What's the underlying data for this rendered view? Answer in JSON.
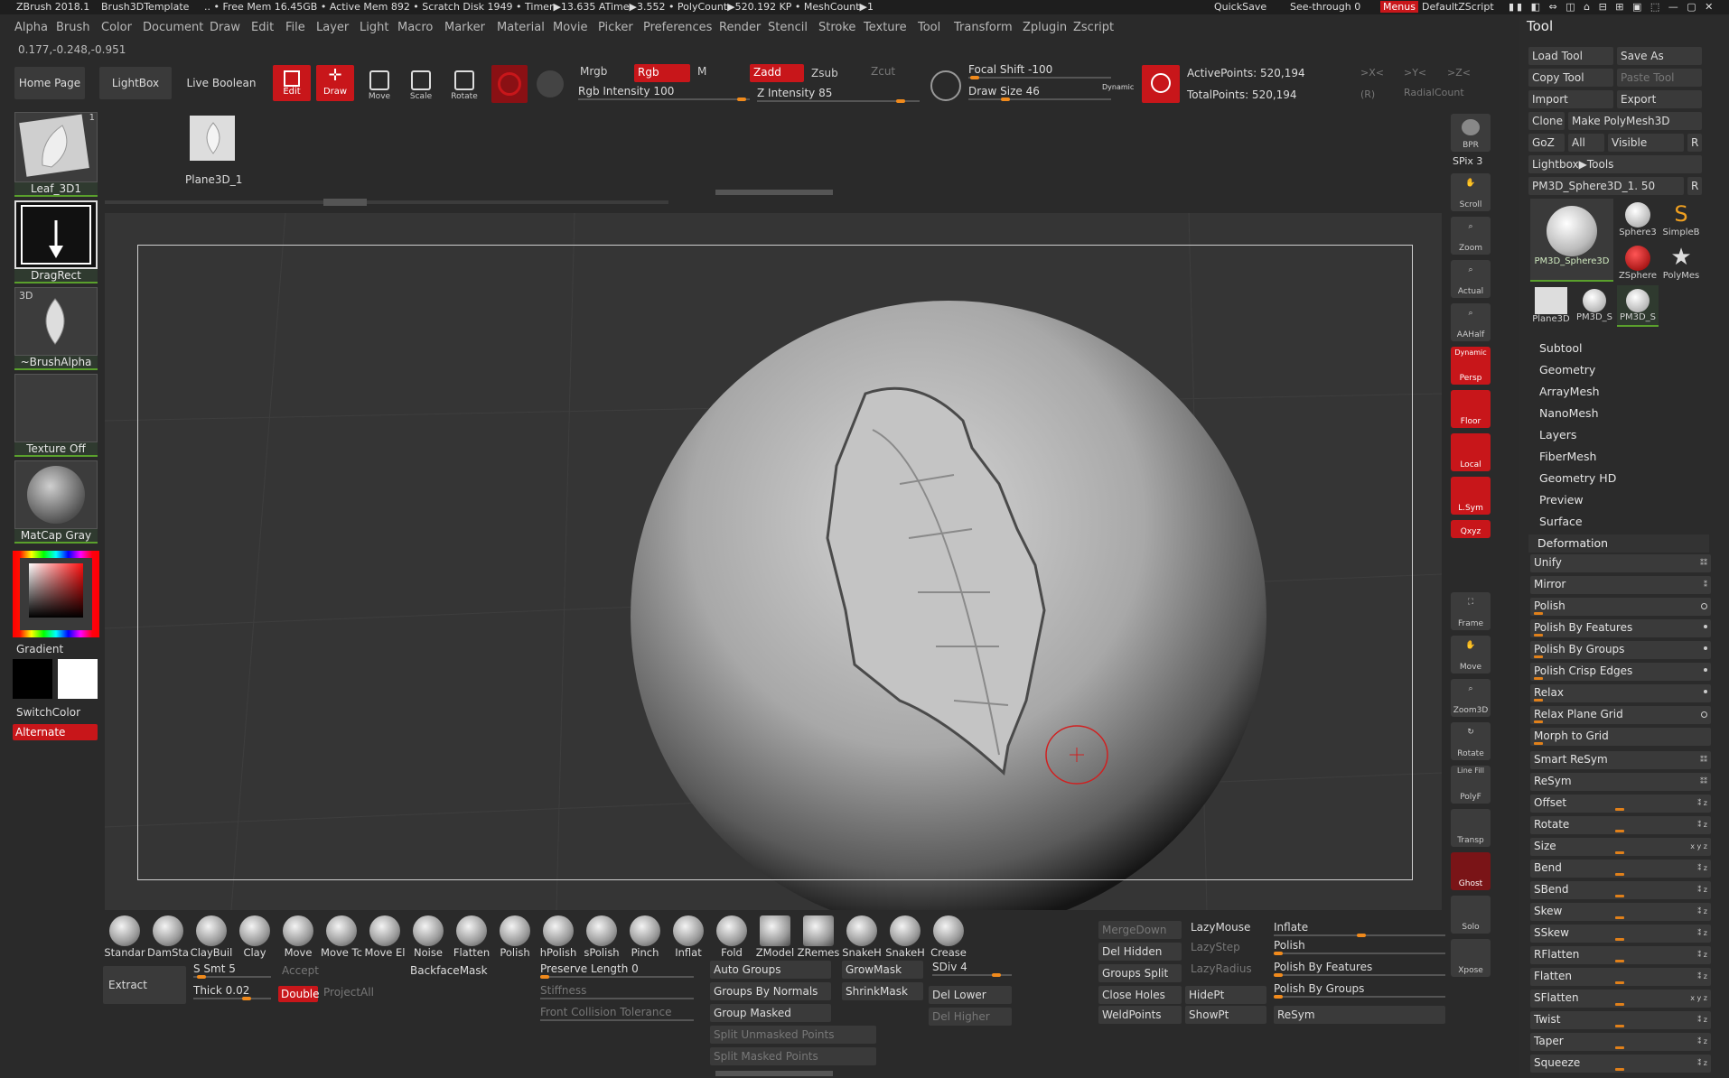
{
  "titlebar": {
    "app": "ZBrush 2018.1",
    "template": "Brush3DTemplate",
    "status": ".. • Free Mem 16.45GB • Active Mem 892 • Scratch Disk 1949 •  Timer▶13.635 ATime▶3.552 • PolyCount▶520.192 KP  • MeshCount▶1",
    "quicksave": "QuickSave",
    "seethrough": "See-through  0",
    "menus": "Menus",
    "defaultzscript": "DefaultZScript"
  },
  "menubar": [
    "Alpha",
    "Brush",
    "Color",
    "Document",
    "Draw",
    "Edit",
    "File",
    "Layer",
    "Light",
    "Macro",
    "Marker",
    "Material",
    "Movie",
    "Picker",
    "Preferences",
    "Render",
    "Stencil",
    "Stroke",
    "Texture",
    "Tool",
    "Transform",
    "Zplugin",
    "Zscript"
  ],
  "coords": "0.177,-0.248,-0.951",
  "top": {
    "home": "Home Page",
    "lightbox": "LightBox",
    "liveboolean": "Live Boolean",
    "modes": [
      "Edit",
      "Draw",
      "Move",
      "Scale",
      "Rotate"
    ],
    "mrgb": "Mrgb",
    "rgb": "Rgb",
    "m": "M",
    "rgb_intensity": "Rgb Intensity 100",
    "zadd": "Zadd",
    "zsub": "Zsub",
    "zcut": "Zcut",
    "z_intensity": "Z Intensity 85",
    "focal_shift": "Focal Shift -100",
    "draw_size": "Draw Size 46",
    "dynamic": "Dynamic",
    "active_points": "ActivePoints: 520,194",
    "total_points": "TotalPoints: 520,194",
    "x": ">X<",
    "y": ">Y<",
    "z": ">Z<",
    "r": "(R)",
    "radialcount": "RadialCount"
  },
  "left": {
    "tool_name": "Leaf_3D1",
    "tool_count": "1",
    "stroke": "DragRect",
    "alpha_tag": "3D",
    "alpha": "~BrushAlpha",
    "texture": "Texture Off",
    "material": "MatCap Gray",
    "gradient": "Gradient",
    "switchcolor": "SwitchColor",
    "alternate": "Alternate"
  },
  "subtool_thumb": "Plane3D_1",
  "right_strip": [
    "BPR",
    "SPix 3",
    "Scroll",
    "Zoom",
    "Actual",
    "AAHalf",
    "Persp",
    "Floor",
    "Local",
    "L.Sym",
    "Qxyz",
    "Frame",
    "Move",
    "Zoom3D",
    "Rotate",
    "PolyF",
    "Transp",
    "Ghost",
    "Solo",
    "Xpose"
  ],
  "right_strip_extra": {
    "dynamic": "Dynamic",
    "linefill": "Line Fill"
  },
  "toolpanel": {
    "title": "Tool",
    "load": "Load Tool",
    "saveas": "Save As",
    "copy": "Copy Tool",
    "paste": "Paste Tool",
    "import": "Import",
    "export": "Export",
    "clone": "Clone",
    "makepoly": "Make PolyMesh3D",
    "goz": "GoZ",
    "all": "All",
    "visible": "Visible",
    "r": "R",
    "lightboxtools": "Lightbox▶Tools",
    "current": "PM3D_Sphere3D_1. 50",
    "thumbs": [
      "PM3D_Sphere3D",
      "Sphere3",
      "SimpleB",
      "ZSphere",
      "PolyMes",
      "Plane3D",
      "PM3D_S",
      "PM3D_S"
    ],
    "sections": [
      "Subtool",
      "Geometry",
      "ArrayMesh",
      "NanoMesh",
      "Layers",
      "FiberMesh",
      "Geometry HD",
      "Preview",
      "Surface"
    ],
    "deformation": "Deformation",
    "def_items": [
      "Unify",
      "Mirror",
      "Polish",
      "Polish By Features",
      "Polish By Groups",
      "Polish Crisp Edges",
      "Relax",
      "Relax Plane Grid",
      "Morph to Grid",
      "Smart ReSym",
      "ReSym",
      "Offset",
      "Rotate",
      "Size",
      "Bend",
      "SBend",
      "Skew",
      "SSkew",
      "RFlatten",
      "Flatten",
      "SFlatten",
      "Twist",
      "Taper",
      "Squeeze"
    ]
  },
  "brushes": [
    "Standar",
    "DamSta",
    "ClayBuil",
    "Clay",
    "Move",
    "Move Tc",
    "Move El",
    "Noise",
    "Flatten",
    "Polish",
    "hPolish",
    "sPolish",
    "Pinch",
    "Inflat",
    "Fold",
    "ZModel",
    "ZRemes",
    "SnakeH",
    "SnakeH",
    "Crease"
  ],
  "bottom": {
    "extract": "Extract",
    "ssmt": "S Smt 5",
    "accept": "Accept",
    "thick": "Thick 0.02",
    "double": "Double",
    "projectall": "ProjectAll",
    "backfacemask": "BackfaceMask",
    "preserve": "Preserve Length 0",
    "stiffness": "Stiffness",
    "frontcollision": "Front Collision Tolerance",
    "autogroups": "Auto Groups",
    "groupsbynormals": "Groups By Normals",
    "groupmasked": "Group Masked",
    "splitunmasked": "Split Unmasked Points",
    "splitmasked": "Split Masked Points",
    "growmask": "GrowMask",
    "shrinkmask": "ShrinkMask",
    "sdiv": "SDiv 4",
    "dellower": "Del Lower",
    "delhigher": "Del Higher",
    "mergedown": "MergeDown",
    "delhidden": "Del Hidden",
    "groupssplit": "Groups Split",
    "closeholes": "Close Holes",
    "weldpoints": "WeldPoints",
    "lazymouse": "LazyMouse",
    "lazystep": "LazyStep",
    "lazyradius": "LazyRadius",
    "hidept": "HidePt",
    "showpt": "ShowPt",
    "inflate": "Inflate",
    "polish": "Polish",
    "polishfeatures": "Polish By Features",
    "polishgroups": "Polish By Groups",
    "resym": "ReSym"
  },
  "colors": {
    "accent_red": "#c8161a",
    "slider_orange": "#e0801a",
    "active_green": "#5aa02c"
  }
}
